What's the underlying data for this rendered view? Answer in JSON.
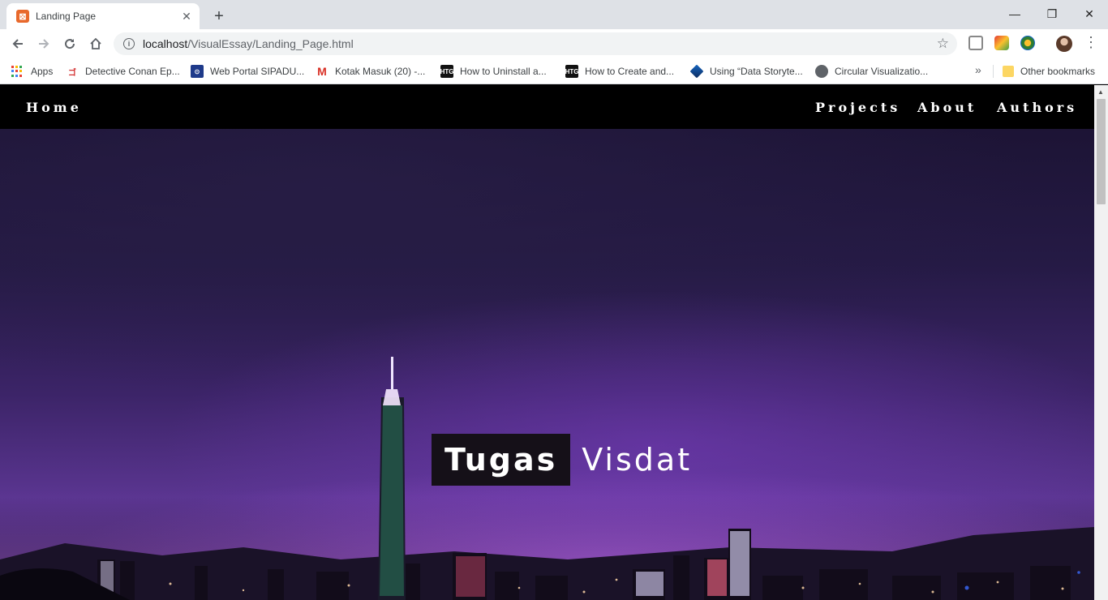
{
  "browser": {
    "tab": {
      "title": "Landing Page",
      "favicon": "xampp-favicon-icon"
    },
    "address": {
      "host": "localhost",
      "path": "/VisualEssay/Landing_Page.html"
    },
    "bookmarks": [
      {
        "label": "Apps",
        "icon": "apps-grid-icon"
      },
      {
        "label": "Detective Conan Ep...",
        "icon": "site-favicon-icon"
      },
      {
        "label": "Web Portal SIPADU...",
        "icon": "site-favicon-icon"
      },
      {
        "label": "Kotak Masuk (20) -...",
        "icon": "gmail-icon"
      },
      {
        "label": "How to Uninstall a...",
        "icon": "htg-icon"
      },
      {
        "label": "How to Create and...",
        "icon": "htg-icon"
      },
      {
        "label": "Using “Data Storyte...",
        "icon": "site-favicon-icon"
      },
      {
        "label": "Circular Visualizatio...",
        "icon": "globe-icon"
      }
    ],
    "other_bookmarks": "Other bookmarks",
    "overflow": "»",
    "htg_label": "HTG"
  },
  "site": {
    "nav": {
      "home": "Home",
      "projects": "Projects",
      "about": "About",
      "authors": "Authors"
    },
    "hero": {
      "title_highlight": "Tugas",
      "title_rest": "Visdat"
    }
  },
  "colors": {
    "tab_favicon": "#e8692c",
    "nav_background": "#000000",
    "title_box": "#151018"
  }
}
